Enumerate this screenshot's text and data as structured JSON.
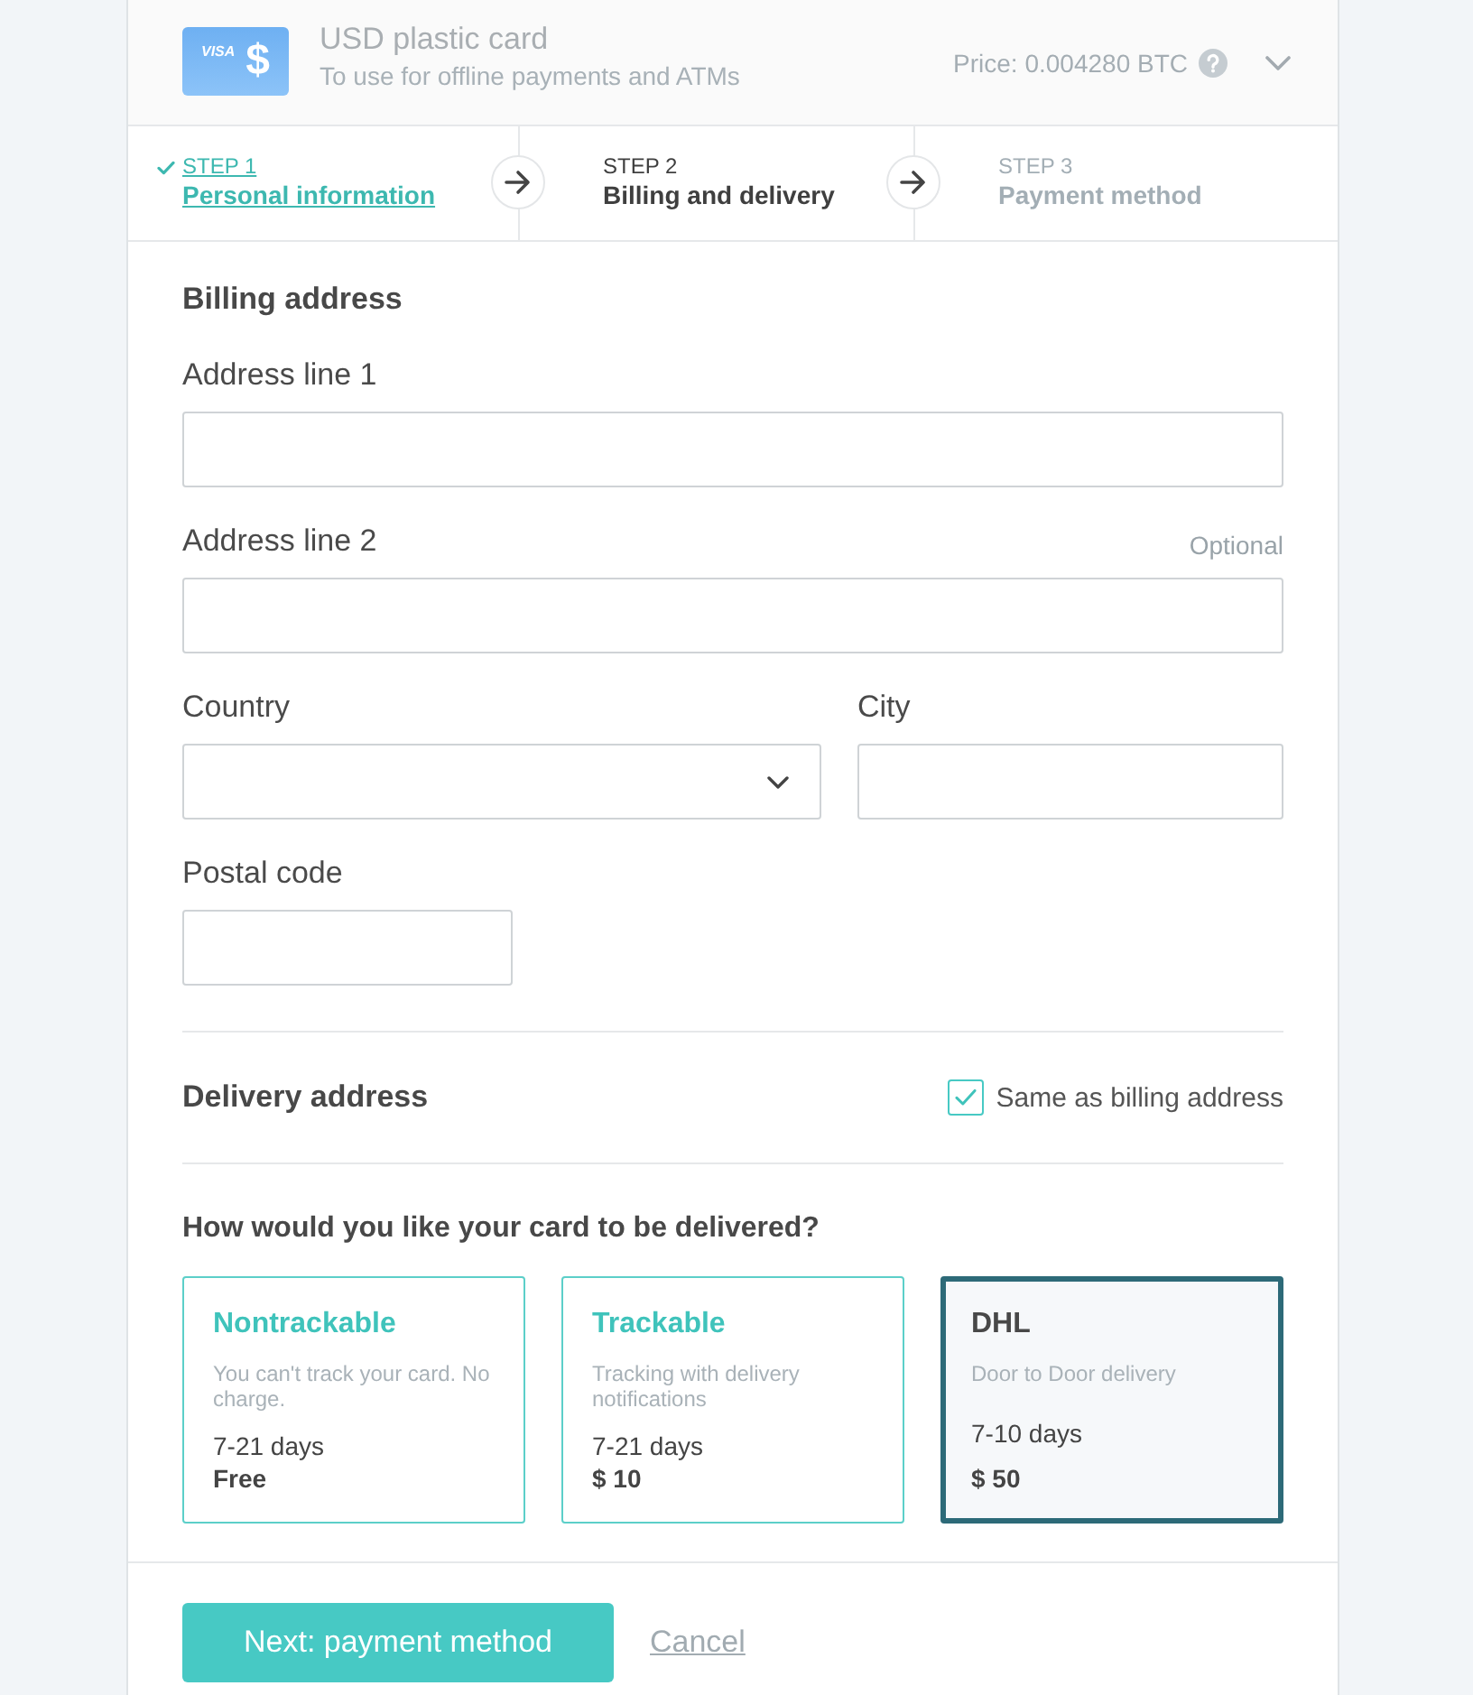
{
  "product": {
    "card_brand": "VISA",
    "currency_symbol": "$",
    "title": "USD plastic card",
    "subtitle": "To use for offline payments and ATMs",
    "price": "Price: 0.004280 BTC",
    "expanded": false
  },
  "steps": [
    {
      "number": "STEP 1",
      "label": "Personal information",
      "completed": true,
      "selected": false
    },
    {
      "number": "STEP 2",
      "label": "Billing and delivery",
      "completed": false,
      "selected": true
    },
    {
      "number": "STEP 3",
      "label": "Payment method",
      "completed": false,
      "selected": false
    }
  ],
  "billing": {
    "title": "Billing address",
    "rows": [
      [
        {
          "label": "Address line 1",
          "kind": "text"
        }
      ],
      [
        {
          "label": "Address line 2",
          "kind": "text",
          "note": "Optional"
        }
      ],
      [
        {
          "label": "Country",
          "kind": "select"
        },
        {
          "label": "City",
          "kind": "text"
        }
      ],
      [
        {
          "label": "Postal code",
          "kind": "short-text"
        }
      ]
    ]
  },
  "delivery": {
    "title": "Delivery address",
    "same_as_billing": {
      "label": "Same as billing address",
      "checked": true
    }
  },
  "shipping": {
    "question": "How would you like your card to be delivered?",
    "options": [
      {
        "name": "Nontrackable",
        "description": "You can't track your card. No charge.",
        "duration": "7-21 days",
        "price": "Free",
        "selected": false
      },
      {
        "name": "Trackable",
        "description": "Tracking with delivery notifications",
        "duration": "7-21 days",
        "price": "$ 10",
        "selected": false
      },
      {
        "name": "DHL",
        "description": "Door to Door delivery",
        "duration": "7-10 days",
        "price": "$ 50",
        "selected": true
      }
    ]
  },
  "actions": {
    "primary": "Next: payment method",
    "cancel": "Cancel"
  }
}
